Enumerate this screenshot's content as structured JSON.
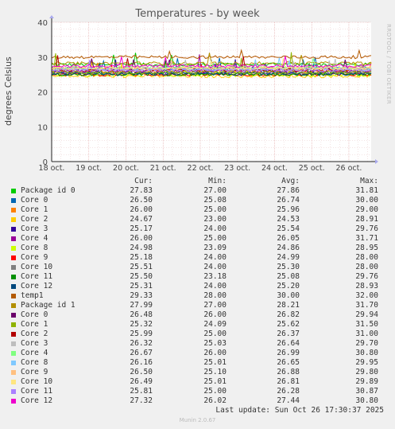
{
  "side_text": "RRDTOOL / TOBI OETIKER",
  "munin_version": "Munin 2.0.67",
  "last_update": "Last update: Sun Oct 26 17:30:37 2025",
  "legend_headers": {
    "cur": "Cur:",
    "min": "Min:",
    "avg": "Avg:",
    "max": "Max:"
  },
  "chart_data": {
    "type": "line",
    "title": "Temperatures - by week",
    "ylabel": "degrees Celsius",
    "ylim": [
      0,
      40
    ],
    "yticks": [
      "0",
      "10",
      "20",
      "30",
      "40"
    ],
    "xticks": [
      "18 oct.",
      "19 oct.",
      "20 oct.",
      "21 oct.",
      "22 oct.",
      "23 oct.",
      "24 oct.",
      "25 oct.",
      "26 oct."
    ],
    "grid": true,
    "series": [
      {
        "name": "Package id 0",
        "color": "#00cc00",
        "cur": "27.83",
        "min": "27.00",
        "avg": "27.86",
        "max": "31.81"
      },
      {
        "name": "Core 0",
        "color": "#0066b3",
        "cur": "26.50",
        "min": "25.08",
        "avg": "26.74",
        "max": "30.00"
      },
      {
        "name": "Core 1",
        "color": "#ff8000",
        "cur": "26.00",
        "min": "25.00",
        "avg": "25.96",
        "max": "29.00"
      },
      {
        "name": "Core 2",
        "color": "#ffcc00",
        "cur": "24.67",
        "min": "23.00",
        "avg": "24.53",
        "max": "28.91"
      },
      {
        "name": "Core 3",
        "color": "#330099",
        "cur": "25.17",
        "min": "24.00",
        "avg": "25.54",
        "max": "29.76"
      },
      {
        "name": "Core 4",
        "color": "#990099",
        "cur": "26.00",
        "min": "25.00",
        "avg": "26.05",
        "max": "31.71"
      },
      {
        "name": "Core 8",
        "color": "#ccff00",
        "cur": "24.98",
        "min": "23.09",
        "avg": "24.86",
        "max": "28.95"
      },
      {
        "name": "Core 9",
        "color": "#ff0000",
        "cur": "25.18",
        "min": "24.00",
        "avg": "24.99",
        "max": "28.00"
      },
      {
        "name": "Core 10",
        "color": "#808080",
        "cur": "25.51",
        "min": "24.00",
        "avg": "25.30",
        "max": "28.00"
      },
      {
        "name": "Core 11",
        "color": "#008f00",
        "cur": "25.50",
        "min": "23.18",
        "avg": "25.08",
        "max": "29.76"
      },
      {
        "name": "Core 12",
        "color": "#00487d",
        "cur": "25.31",
        "min": "24.00",
        "avg": "25.20",
        "max": "28.93"
      },
      {
        "name": "temp1",
        "color": "#b35a00",
        "cur": "29.33",
        "min": "28.00",
        "avg": "30.00",
        "max": "32.00"
      },
      {
        "name": "Package id 1",
        "color": "#b38f00",
        "cur": "27.99",
        "min": "27.00",
        "avg": "28.21",
        "max": "31.70"
      },
      {
        "name": "Core 0",
        "color": "#6b006b",
        "cur": "26.48",
        "min": "26.00",
        "avg": "26.82",
        "max": "29.94"
      },
      {
        "name": "Core 1",
        "color": "#8fb300",
        "cur": "25.32",
        "min": "24.09",
        "avg": "25.62",
        "max": "31.50"
      },
      {
        "name": "Core 2",
        "color": "#b30000",
        "cur": "25.99",
        "min": "25.00",
        "avg": "26.37",
        "max": "31.00"
      },
      {
        "name": "Core 3",
        "color": "#bebebe",
        "cur": "26.32",
        "min": "25.03",
        "avg": "26.64",
        "max": "29.70"
      },
      {
        "name": "Core 4",
        "color": "#80ff80",
        "cur": "26.67",
        "min": "26.00",
        "avg": "26.99",
        "max": "30.80"
      },
      {
        "name": "Core 8",
        "color": "#80c9ff",
        "cur": "26.16",
        "min": "25.01",
        "avg": "26.65",
        "max": "29.95"
      },
      {
        "name": "Core 9",
        "color": "#ffc080",
        "cur": "26.50",
        "min": "25.10",
        "avg": "26.88",
        "max": "29.80"
      },
      {
        "name": "Core 10",
        "color": "#ffe680",
        "cur": "26.49",
        "min": "25.01",
        "avg": "26.81",
        "max": "29.89"
      },
      {
        "name": "Core 11",
        "color": "#aa80ff",
        "cur": "25.81",
        "min": "25.00",
        "avg": "26.28",
        "max": "30.87"
      },
      {
        "name": "Core 12",
        "color": "#ee00cc",
        "cur": "27.32",
        "min": "26.02",
        "avg": "27.44",
        "max": "30.80"
      }
    ]
  }
}
